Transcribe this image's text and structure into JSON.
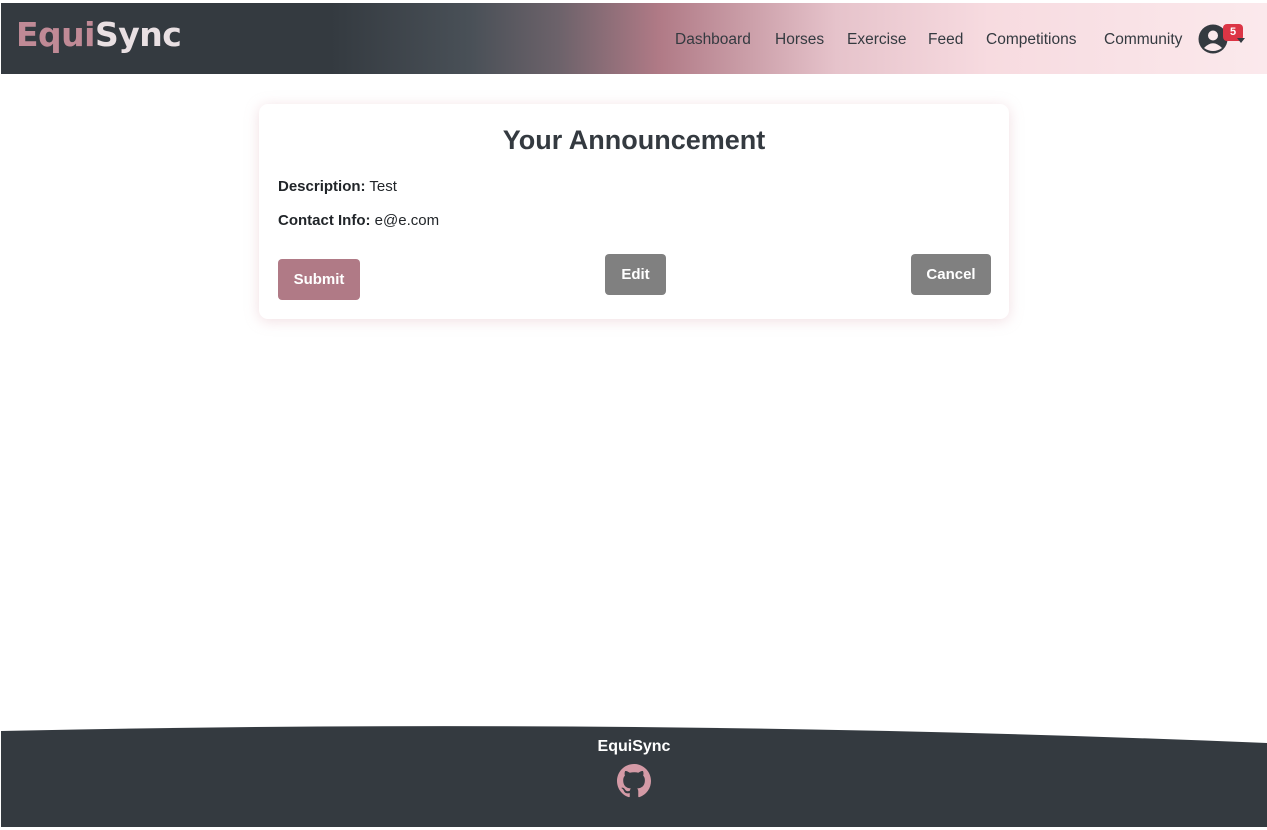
{
  "header": {
    "logo_part1": "E",
    "logo_part2": "qui",
    "logo_part3": "Sync",
    "nav": [
      "Dashboard",
      "Horses",
      "Exercise",
      "Feed",
      "Competitions",
      "Community"
    ],
    "notification_count": "5"
  },
  "card": {
    "title": "Your Announcement",
    "description_label": "Description:",
    "description_value": "Test",
    "contact_label": "Contact Info:",
    "contact_value": "e@e.com",
    "submit_label": "Submit",
    "edit_label": "Edit",
    "cancel_label": "Cancel"
  },
  "footer": {
    "brand": "EquiSync",
    "icon": "github-icon"
  },
  "colors": {
    "accent": "#b07a86",
    "dark": "#343a40",
    "badge": "#dc3545",
    "button_gray": "#808080"
  }
}
